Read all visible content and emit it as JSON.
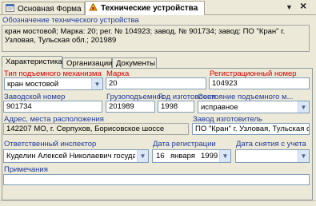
{
  "tabs": {
    "main_form": "Основная Форма",
    "tech_devices": "Технические устройства"
  },
  "window_controls": {
    "close": "×",
    "dropdown": "▼"
  },
  "device_designation": {
    "label": "Обозначение технического устройства",
    "value": "кран мостовой; Марка: 20; рег. № 104923; завод. № 901734; завод: ПО \"Кран\" г. Узловая, Тульская обл.; 201989"
  },
  "inner_tabs": [
    "Характеристика",
    "Организации",
    "Документы"
  ],
  "fields": {
    "lift_type": {
      "label": "Тип подъемного механизма",
      "value": "кран мостовой"
    },
    "brand": {
      "label": "Марка",
      "value": "20"
    },
    "reg_number": {
      "label": "Регистрационный номер",
      "value": "104923"
    },
    "factory_number": {
      "label": "Заводской номер",
      "value": "901734"
    },
    "capacity": {
      "label": "Грузоподъемнос",
      "value": "201989"
    },
    "year": {
      "label": "Год изготовлени",
      "value": "1998"
    },
    "state": {
      "label": "Состояние подъемного м...",
      "value": "исправное"
    },
    "address": {
      "label": "Адрес, места расположения",
      "value": "142207 МО, г. Серпухов, Борисовское шоссе"
    },
    "manufacturer": {
      "label": "Завод изготовитель",
      "value": "ПО \"Кран\" г. Узловая, Тульская обл"
    },
    "inspector": {
      "label": "Ответственный инспектор",
      "value": "Куделин Алексей Николаевич  государст"
    },
    "reg_date": {
      "label": "Дата регистрации",
      "day": "16",
      "month": "января",
      "year": "1999"
    },
    "removal_date": {
      "label": "Дата снятия с учета",
      "value": ""
    },
    "notes": {
      "label": "Примечания",
      "value": ""
    }
  },
  "colors": {
    "label_blue": "#1f3a9d",
    "label_red": "#d40000",
    "panel": "#ece9d8"
  }
}
